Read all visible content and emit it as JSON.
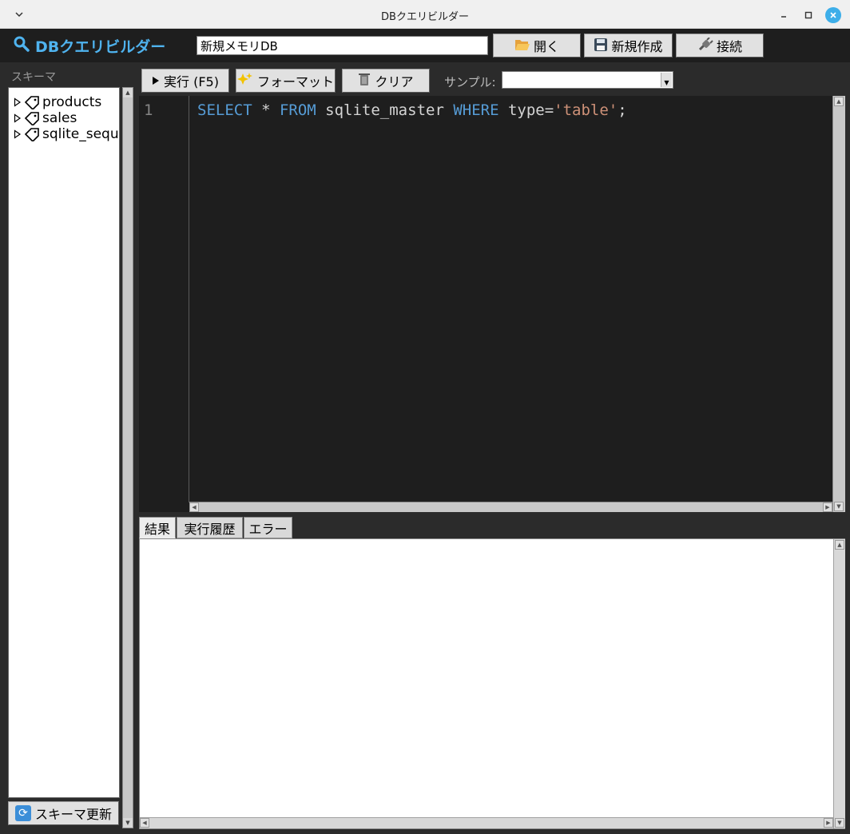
{
  "window": {
    "title": "DBクエリビルダー"
  },
  "header": {
    "brand": "DBクエリビルダー",
    "db_name_value": "新規メモリDB",
    "open_label": "開く",
    "new_label": "新規作成",
    "connect_label": "接続"
  },
  "sidebar": {
    "label": "スキーマ",
    "tables": [
      {
        "name": "products"
      },
      {
        "name": "sales"
      },
      {
        "name": "sqlite_seque"
      }
    ],
    "refresh_label": "スキーマ更新"
  },
  "toolbar": {
    "run_label": "実行 (F5)",
    "format_label": "フォーマット",
    "clear_label": "クリア",
    "sample_label": "サンプル:",
    "sample_value": ""
  },
  "editor": {
    "line_number": "1",
    "tokens": {
      "select": "SELECT",
      "star": " * ",
      "from": "FROM",
      "table": " sqlite_master ",
      "where": "WHERE",
      "cond": " type=",
      "literal": "'table'",
      "end": ";"
    }
  },
  "tabs": [
    {
      "label": "結果"
    },
    {
      "label": "実行履歴"
    },
    {
      "label": "エラー"
    }
  ],
  "colors": {
    "accent": "#4fb3ef",
    "keyword": "#569cd6",
    "string": "#ce9178",
    "editor_bg": "#1e1e1e",
    "app_bg": "#2b2b2b"
  }
}
